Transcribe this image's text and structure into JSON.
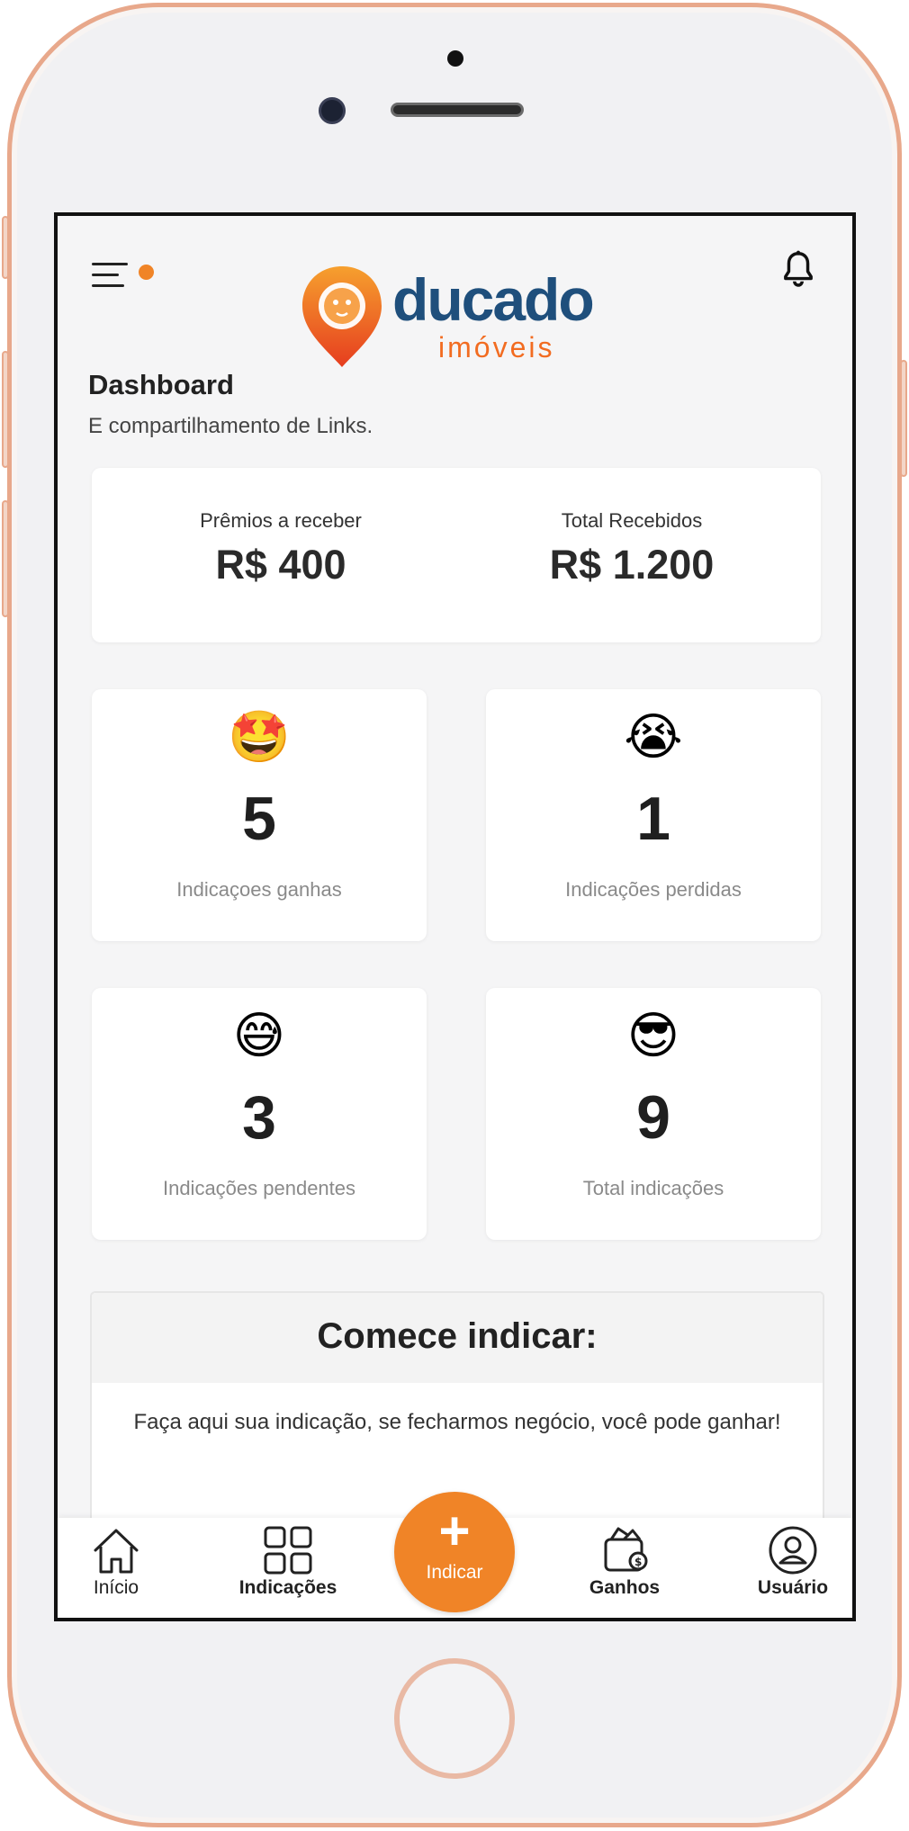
{
  "header": {
    "brand_name": "ducado",
    "brand_sub": "imóveis",
    "page_title": "Dashboard",
    "page_subtitle": "E compartilhamento de Links."
  },
  "summary": {
    "to_receive_label": "Prêmios a receber",
    "to_receive_value": "R$ 400",
    "received_label": "Total Recebidos",
    "received_value": "R$ 1.200"
  },
  "stats": [
    {
      "emoji": "🤩",
      "icon": "star-struck-emoji-icon",
      "value": "5",
      "label": "Indicaçoes ganhas"
    },
    {
      "emoji": "😭",
      "icon": "crying-emoji-icon",
      "value": "1",
      "label": "Indicações perdidas"
    },
    {
      "emoji": "😅",
      "icon": "sweat-smile-emoji-icon",
      "value": "3",
      "label": "Indicações pendentes"
    },
    {
      "emoji": "😎",
      "icon": "sunglasses-emoji-icon",
      "value": "9",
      "label": "Total indicações"
    }
  ],
  "cta": {
    "title": "Comece indicar:",
    "text": "Faça aqui sua indicação, se fecharmos negócio, você pode ganhar!"
  },
  "nav": {
    "home": "Início",
    "referrals": "Indicações",
    "fab_plus": "+",
    "fab_label": "Indicar",
    "earnings": "Ganhos",
    "user": "Usuário"
  },
  "colors": {
    "accent": "#f08427",
    "brand_blue": "#1f4f7c",
    "frame": "#e8a88b"
  }
}
